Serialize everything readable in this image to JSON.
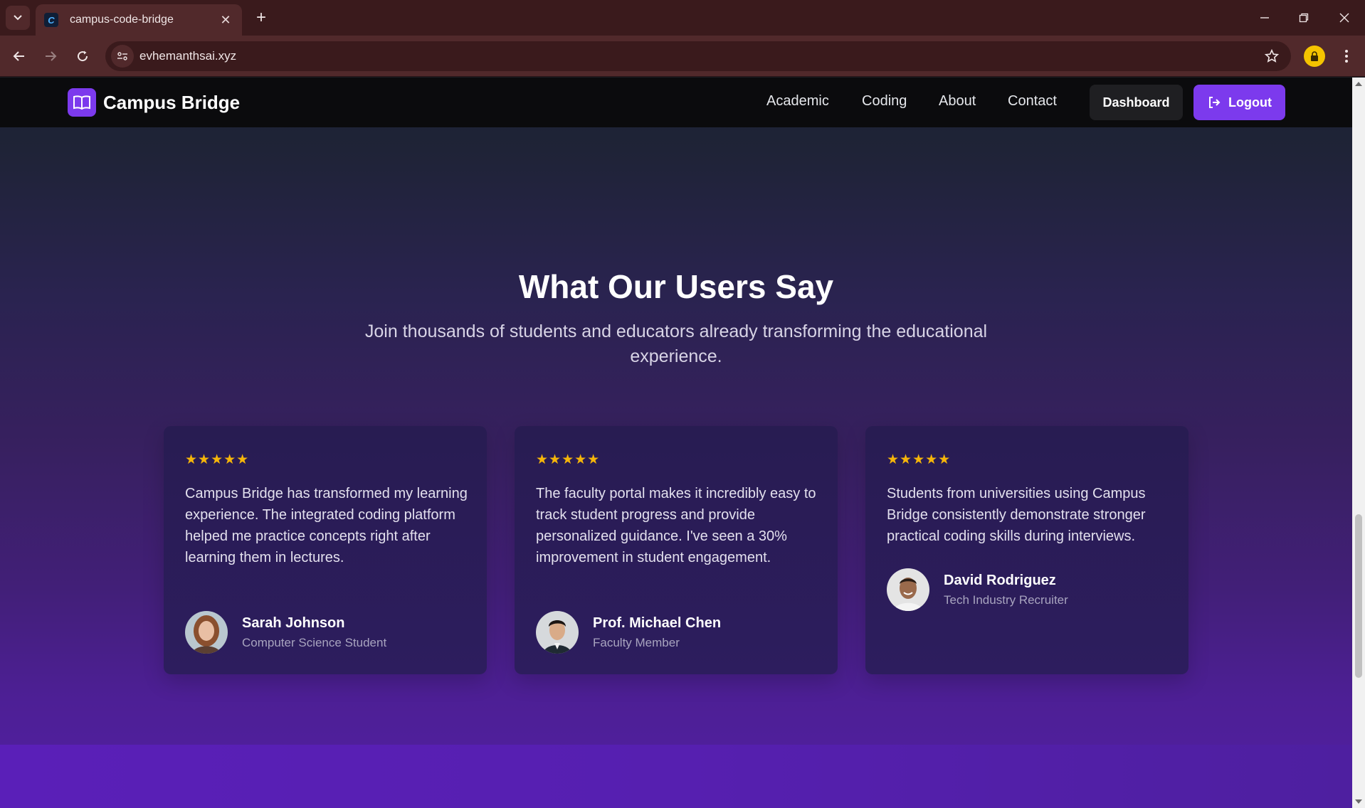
{
  "browser": {
    "tab_title": "campus-code-bridge",
    "favicon_letter": "C",
    "url": "evhemanthsai.xyz",
    "icons": [
      "tab-list-icon",
      "close-tab-icon",
      "new-tab-icon",
      "minimize-icon",
      "restore-icon",
      "close-window-icon",
      "back-icon",
      "forward-icon",
      "reload-icon",
      "site-info-icon",
      "bookmark-star-icon",
      "profile-icon",
      "menu-icon"
    ]
  },
  "header": {
    "brand": "Campus Bridge",
    "nav": [
      "Academic",
      "Coding",
      "About",
      "Contact"
    ],
    "dashboard_label": "Dashboard",
    "logout_label": "Logout"
  },
  "testimonials": {
    "title": "What Our Users Say",
    "subtitle": "Join thousands of students and educators already transforming the educational experience.",
    "items": [
      {
        "stars": "★★★★★",
        "rating": 5,
        "quote": "Campus Bridge has transformed my learning experience. The integrated coding platform helped me practice concepts right after learning them in lectures.",
        "name": "Sarah Johnson",
        "role": "Computer Science Student"
      },
      {
        "stars": "★★★★★",
        "rating": 5,
        "quote": "The faculty portal makes it incredibly easy to track student progress and provide personalized guidance. I've seen a 30% improvement in student engagement.",
        "name": "Prof. Michael Chen",
        "role": "Faculty Member"
      },
      {
        "stars": "★★★★★",
        "rating": 5,
        "quote": "Students from universities using Campus Bridge consistently demonstrate stronger practical coding skills during interviews.",
        "name": "David Rodriguez",
        "role": "Tech Industry Recruiter"
      }
    ]
  },
  "colors": {
    "accent": "#7c3aed",
    "star": "#f5b50a",
    "browser_frame": "#51292b"
  }
}
